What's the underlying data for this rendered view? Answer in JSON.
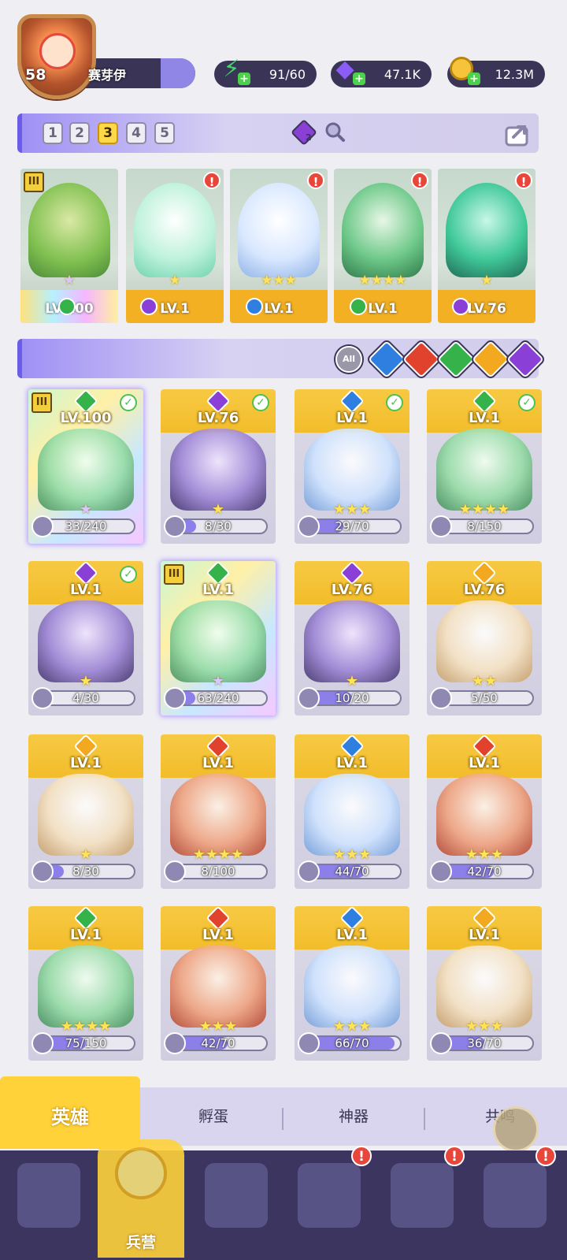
{
  "player": {
    "level": "58",
    "name": "赛芽伊"
  },
  "resources": [
    {
      "icon": "lightning-icon",
      "value": "91/60",
      "color": "#3ed66a"
    },
    {
      "icon": "gem-icon",
      "value": "47.1K",
      "color": "#8b5cf6"
    },
    {
      "icon": "gold-coin-icon",
      "value": "12.3M",
      "color": "#f6c33a"
    }
  ],
  "teams": {
    "tabs": [
      "1",
      "2",
      "3",
      "4",
      "5"
    ],
    "active": "3",
    "badge_count": "2"
  },
  "lineup": [
    {
      "level": "LV.100",
      "element": "wind",
      "stars": "★",
      "rank": "III",
      "alert": false,
      "rainbow": true
    },
    {
      "level": "LV.1",
      "element": "dark",
      "stars": "★",
      "alert": true
    },
    {
      "level": "LV.1",
      "element": "water",
      "stars": "★★★",
      "alert": true
    },
    {
      "level": "LV.1",
      "element": "wind",
      "stars": "★★★★",
      "alert": true
    },
    {
      "level": "LV.76",
      "element": "dark",
      "stars": "★",
      "alert": true
    }
  ],
  "filters": {
    "all_label": "All",
    "elements": [
      {
        "name": "water",
        "color": "#2f7fe0"
      },
      {
        "name": "fire",
        "color": "#e0422e"
      },
      {
        "name": "wind",
        "color": "#36b24a"
      },
      {
        "name": "light",
        "color": "#f2a81f"
      },
      {
        "name": "dark",
        "color": "#8a3fd6"
      }
    ]
  },
  "heroes": [
    {
      "level": "LV.100",
      "fragments": "33/240",
      "progress": 0.14,
      "element": "wind",
      "stars": "★",
      "owned": true,
      "rank": "III",
      "rainbow": true
    },
    {
      "level": "LV.76",
      "fragments": "8/30",
      "progress": 0.27,
      "element": "dark",
      "stars": "★",
      "owned": true
    },
    {
      "level": "LV.1",
      "fragments": "29/70",
      "progress": 0.41,
      "element": "water",
      "stars": "★★★",
      "owned": true
    },
    {
      "level": "LV.1",
      "fragments": "8/150",
      "progress": 0.05,
      "element": "wind",
      "stars": "★★★★",
      "owned": true
    },
    {
      "level": "LV.1",
      "fragments": "4/30",
      "progress": 0.13,
      "element": "dark",
      "stars": "★",
      "owned": true
    },
    {
      "level": "LV.1",
      "fragments": "63/240",
      "progress": 0.26,
      "element": "wind",
      "stars": "★",
      "rank": "III",
      "rainbow": true
    },
    {
      "level": "LV.76",
      "fragments": "10/20",
      "progress": 0.5,
      "element": "dark",
      "stars": "★"
    },
    {
      "level": "LV.76",
      "fragments": "5/50",
      "progress": 0.1,
      "element": "light",
      "stars": "★★"
    },
    {
      "level": "LV.1",
      "fragments": "8/30",
      "progress": 0.27,
      "element": "light",
      "stars": "★"
    },
    {
      "level": "LV.1",
      "fragments": "8/100",
      "progress": 0.08,
      "element": "fire",
      "stars": "★★★★"
    },
    {
      "level": "LV.1",
      "fragments": "44/70",
      "progress": 0.63,
      "element": "water",
      "stars": "★★★"
    },
    {
      "level": "LV.1",
      "fragments": "42/70",
      "progress": 0.6,
      "element": "fire",
      "stars": "★★★"
    },
    {
      "level": "LV.1",
      "fragments": "75/150",
      "progress": 0.5,
      "element": "wind",
      "stars": "★★★★"
    },
    {
      "level": "LV.1",
      "fragments": "42/70",
      "progress": 0.6,
      "element": "fire",
      "stars": "★★★"
    },
    {
      "level": "LV.1",
      "fragments": "66/70",
      "progress": 0.94,
      "element": "water",
      "stars": "★★★"
    },
    {
      "level": "LV.1",
      "fragments": "36/70",
      "progress": 0.51,
      "element": "light",
      "stars": "★★★"
    }
  ],
  "subtabs": [
    "英雄",
    "孵蛋",
    "神器",
    "共鸣"
  ],
  "nav": {
    "active_label": "兵营",
    "items": [
      "cards-icon",
      "barracks-icon",
      "map-book-icon",
      "temple-icon",
      "mushroom-house-icon",
      "banner-icon"
    ],
    "alerts": [
      false,
      false,
      false,
      true,
      true,
      true
    ]
  },
  "colors": {
    "water": "#2f7fe0",
    "fire": "#e0422e",
    "wind": "#36b24a",
    "light": "#f2a81f",
    "dark": "#8a3fd6",
    "accent": "#ffd23a"
  }
}
